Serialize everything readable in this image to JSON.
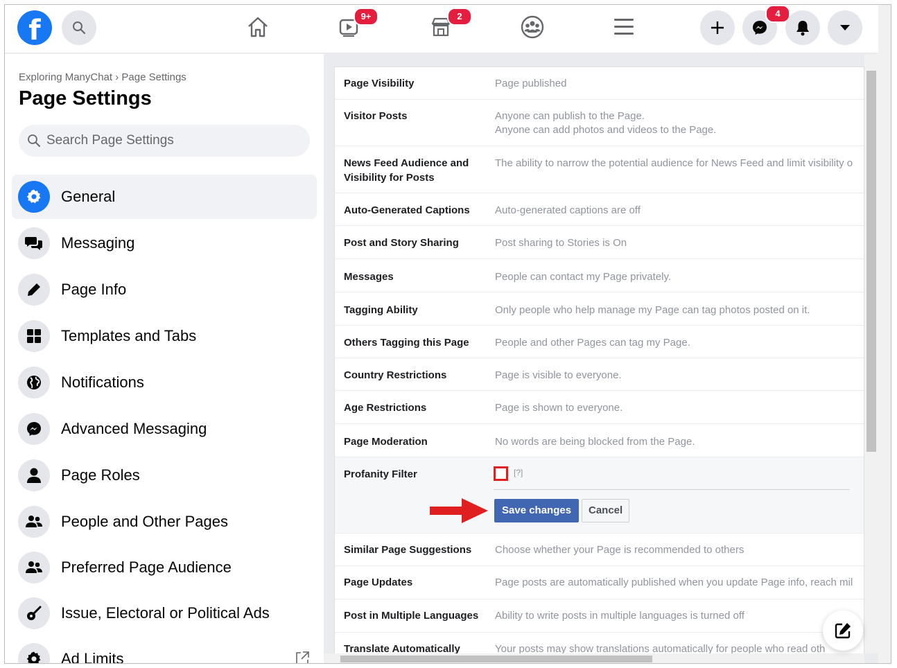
{
  "nav": {
    "watch_badge": "9+",
    "marketplace_badge": "2",
    "messenger_badge": "4",
    "icons": [
      "facebook-logo",
      "search-icon",
      "home-icon",
      "watch-icon",
      "marketplace-icon",
      "groups-icon",
      "menu-icon",
      "plus-icon",
      "messenger-icon",
      "bell-icon",
      "caret-down-icon"
    ]
  },
  "sidebar": {
    "breadcrumb": "Exploring ManyChat › Page Settings",
    "title": "Page Settings",
    "search_placeholder": "Search Page Settings",
    "items": [
      {
        "label": "General",
        "icon": "gear-icon",
        "active": true
      },
      {
        "label": "Messaging",
        "icon": "chat-bubbles-icon"
      },
      {
        "label": "Page Info",
        "icon": "pencil-icon"
      },
      {
        "label": "Templates and Tabs",
        "icon": "grid-icon"
      },
      {
        "label": "Notifications",
        "icon": "globe-icon"
      },
      {
        "label": "Advanced Messaging",
        "icon": "messenger-icon"
      },
      {
        "label": "Page Roles",
        "icon": "person-icon"
      },
      {
        "label": "People and Other Pages",
        "icon": "people-icon"
      },
      {
        "label": "Preferred Page Audience",
        "icon": "people-icon"
      },
      {
        "label": "Issue, Electoral or Political Ads",
        "icon": "guitar-icon"
      },
      {
        "label": "Ad Limits",
        "icon": "gear-icon"
      }
    ]
  },
  "settings": {
    "rows": [
      {
        "label": "Page Visibility",
        "value": "Page published"
      },
      {
        "label": "Visitor Posts",
        "value": "Anyone can publish to the Page.",
        "value2": "Anyone can add photos and videos to the Page."
      },
      {
        "label": "News Feed Audience and",
        "label2": "Visibility for Posts",
        "value": "The ability to narrow the potential audience for News Feed and limit visibility o"
      },
      {
        "label": "Auto-Generated Captions",
        "value": "Auto-generated captions are off"
      },
      {
        "label": "Post and Story Sharing",
        "value": "Post sharing to Stories is On"
      },
      {
        "label": "Messages",
        "value": "People can contact my Page privately."
      },
      {
        "label": "Tagging Ability",
        "value": "Only people who help manage my Page can tag photos posted on it."
      },
      {
        "label": "Others Tagging this Page",
        "value": "People and other Pages can tag my Page."
      },
      {
        "label": "Country Restrictions",
        "value": "Page is visible to everyone."
      },
      {
        "label": "Age Restrictions",
        "value": "Page is shown to everyone."
      },
      {
        "label": "Page Moderation",
        "value": "No words are being blocked from the Page."
      }
    ],
    "profanity": {
      "label": "Profanity Filter",
      "help": "[?]",
      "checked": false,
      "save_label": "Save changes",
      "cancel_label": "Cancel"
    },
    "rows_after": [
      {
        "label": "Similar Page Suggestions",
        "value": "Choose whether your Page is recommended to others"
      },
      {
        "label": "Page Updates",
        "value": "Page posts are automatically published when you update Page info, reach mil"
      },
      {
        "label": "Post in Multiple Languages",
        "value": "Ability to write posts in multiple languages is turned off"
      },
      {
        "label": "Translate Automatically",
        "value": "Your posts may show translations automatically for people who read oth"
      }
    ]
  },
  "colors": {
    "brand": "#1877f2",
    "badge": "#e41e3f",
    "save_button": "#4267b2",
    "annotation_red": "#e02020"
  }
}
